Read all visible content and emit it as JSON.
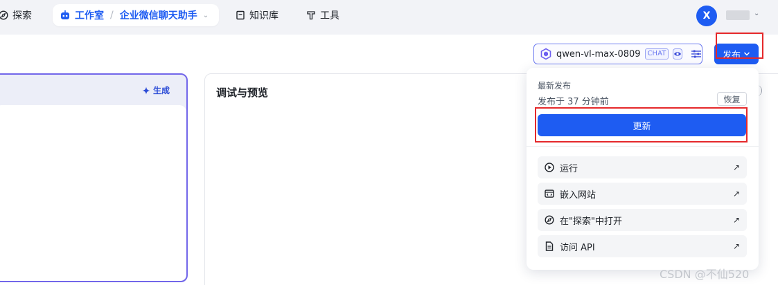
{
  "topnav": {
    "explore_label": "探索",
    "breadcrumb": {
      "studio_label": "工作室",
      "separator": "/",
      "app_name": "企业微信聊天助手"
    },
    "knowledge_label": "知识库",
    "tools_label": "工具",
    "user": {
      "avatar_initial": "X"
    }
  },
  "toolbar": {
    "model_name": "qwen-vl-max-0809",
    "model_badge": "CHAT",
    "publish_label": "发布"
  },
  "left_panel": {
    "generate_label": "生成"
  },
  "preview": {
    "title": "调试与预览"
  },
  "publish_menu": {
    "heading": "最新发布",
    "published_time": "发布于 37 分钟前",
    "restore_label": "恢复",
    "update_label": "更新",
    "items": [
      {
        "label": "运行",
        "icon": "play-circle-icon"
      },
      {
        "label": "嵌入网站",
        "icon": "embed-icon"
      },
      {
        "label": "在\"探索\"中打开",
        "icon": "compass-icon"
      },
      {
        "label": "访问 API",
        "icon": "document-icon"
      }
    ]
  },
  "watermark": "CSDN @不仙520",
  "colors": {
    "primary": "#1e5cf2",
    "highlight_border": "#e5282a",
    "panel_accent": "#7266ea"
  }
}
